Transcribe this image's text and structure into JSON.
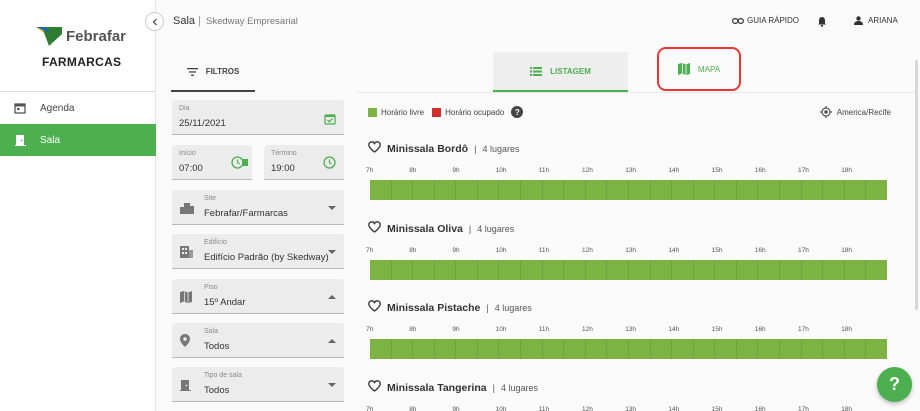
{
  "brand": {
    "name": "Febrafar",
    "sub": "FARMARCAS",
    "colors": {
      "primary": "#4caf50",
      "free": "#7cb342",
      "occupied": "#d32f2f"
    }
  },
  "sidebar": {
    "items": [
      {
        "label": "Agenda",
        "icon": "calendar-icon",
        "active": false
      },
      {
        "label": "Sala",
        "icon": "door-icon",
        "active": true
      }
    ]
  },
  "header": {
    "title": "Sala",
    "separator": "|",
    "company": "Skedway Empresarial",
    "guide": "GUIA RÁPIDO",
    "user": "ARIANA"
  },
  "filters": {
    "tab_label": "FILTROS",
    "date": {
      "label": "Dia",
      "value": "25/11/2021"
    },
    "start": {
      "label": "Início",
      "value": "07:00"
    },
    "end": {
      "label": "Término",
      "value": "19:00"
    },
    "site": {
      "label": "Site",
      "value": "Febrafar/Farmarcas"
    },
    "building": {
      "label": "Edifício",
      "value": "Edifício Padrão (by Skedway)"
    },
    "floor": {
      "label": "Piso",
      "value": "15º Andar"
    },
    "room": {
      "label": "Sala",
      "value": "Todos"
    },
    "room_type": {
      "label": "Tipo de sala",
      "value": "Todos"
    }
  },
  "tabs": {
    "list": "LISTAGEM",
    "map": "MAPA"
  },
  "legend": {
    "free": "Horário livre",
    "occupied": "Horário ocupado",
    "help": "?"
  },
  "timezone": "America/Recife",
  "hours": [
    "7h",
    "8h",
    "9h",
    "10h",
    "11h",
    "12h",
    "13h",
    "14h",
    "15h",
    "16h",
    "17h",
    "18h"
  ],
  "rooms": [
    {
      "name": "Minissala Bordô",
      "sep": "|",
      "capacity": "4 lugares"
    },
    {
      "name": "Minissala Oliva",
      "sep": "|",
      "capacity": "4 lugares"
    },
    {
      "name": "Minissala Pistache",
      "sep": "|",
      "capacity": "4 lugares"
    },
    {
      "name": "Minissala Tangerina",
      "sep": "|",
      "capacity": "4 lugares"
    }
  ],
  "fab_label": "?"
}
